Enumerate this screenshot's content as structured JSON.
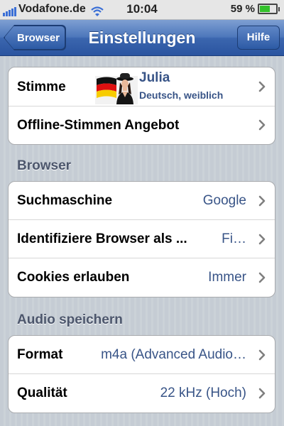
{
  "status_bar": {
    "carrier": "Vodafone.de",
    "time": "10:04",
    "battery_percent": "59 %",
    "battery_level": 0.59,
    "signal_bars": 5
  },
  "nav": {
    "back_label": "Browser",
    "title": "Einstellungen",
    "help_label": "Hilfe"
  },
  "group1": {
    "voice_label": "Stimme",
    "voice_name": "Julia",
    "voice_desc": "Deutsch, weiblich",
    "offline_label": "Offline-Stimmen Angebot"
  },
  "browser_section": {
    "header": "Browser",
    "search_label": "Suchmaschine",
    "search_value": "Google",
    "identify_label": "Identifiziere Browser als ...",
    "identify_value": "Fi…",
    "cookies_label": "Cookies erlauben",
    "cookies_value": "Immer"
  },
  "audio_section": {
    "header": "Audio speichern",
    "format_label": "Format",
    "format_value": "m4a (Advanced Audio…",
    "quality_label": "Qualität",
    "quality_value": "22 kHz (Hoch)"
  },
  "colors": {
    "nav_blue": "#3b66ae",
    "value_blue": "#385487",
    "background": "#c5ccd4"
  }
}
